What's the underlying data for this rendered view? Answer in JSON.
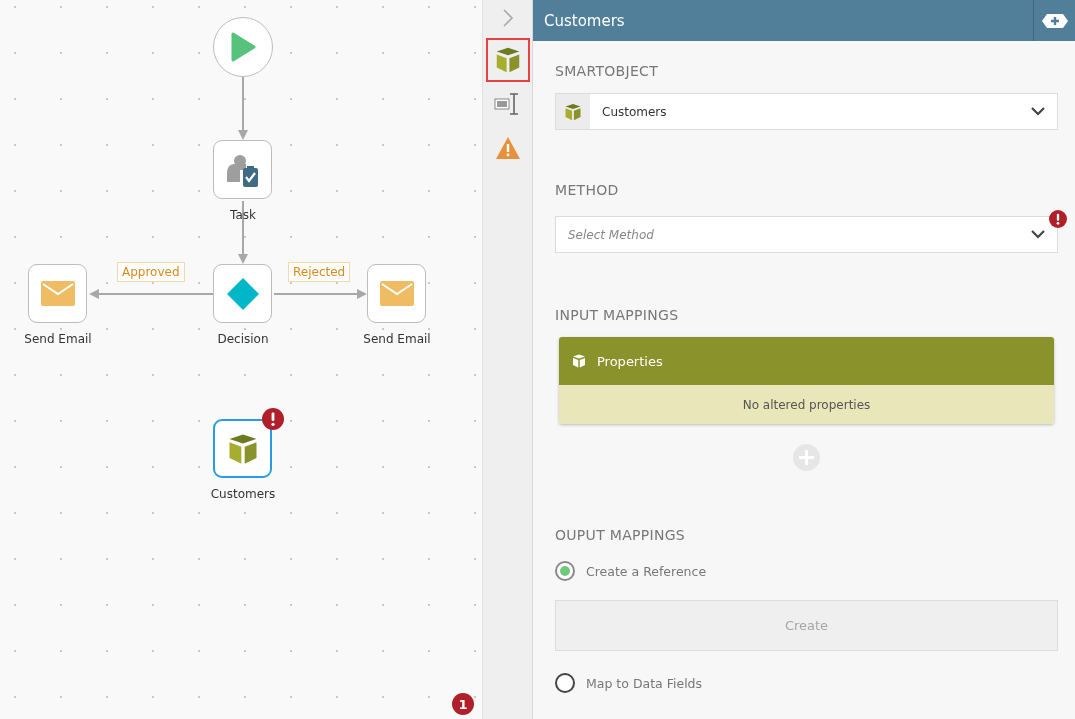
{
  "canvas": {
    "nodes": [
      {
        "kind": "start"
      },
      {
        "kind": "task",
        "label": "Task",
        "selected": false,
        "error": false
      },
      {
        "kind": "email",
        "label": "Send Email",
        "selected": false,
        "error": false
      },
      {
        "kind": "decision",
        "label": "Decision",
        "selected": false,
        "error": false
      },
      {
        "kind": "email",
        "label": "Send Email",
        "selected": false,
        "error": false
      },
      {
        "kind": "smartobject",
        "label": "Customers",
        "selected": true,
        "error": true
      }
    ],
    "branches": [
      {
        "label": "Approved"
      },
      {
        "label": "Rejected"
      }
    ],
    "error_count": "1"
  },
  "rail": {
    "items": [
      {
        "kind": "smartobject",
        "selected": true
      },
      {
        "kind": "format",
        "selected": false
      },
      {
        "kind": "warning",
        "selected": false
      }
    ]
  },
  "panel": {
    "title": "Customers",
    "smartobject": {
      "heading": "SMARTOBJECT",
      "value": "Customers"
    },
    "method": {
      "heading": "METHOD",
      "placeholder": "Select Method",
      "error": true
    },
    "input_mappings": {
      "heading": "INPUT MAPPINGS",
      "card_title": "Properties",
      "empty_text": "No altered properties"
    },
    "output_mappings": {
      "heading": "OUPUT MAPPINGS",
      "options": [
        {
          "label": "Create a Reference",
          "selected": true
        },
        {
          "label": "Map to Data Fields",
          "selected": false
        }
      ],
      "create_button": {
        "label": "Create",
        "disabled": true
      }
    }
  }
}
